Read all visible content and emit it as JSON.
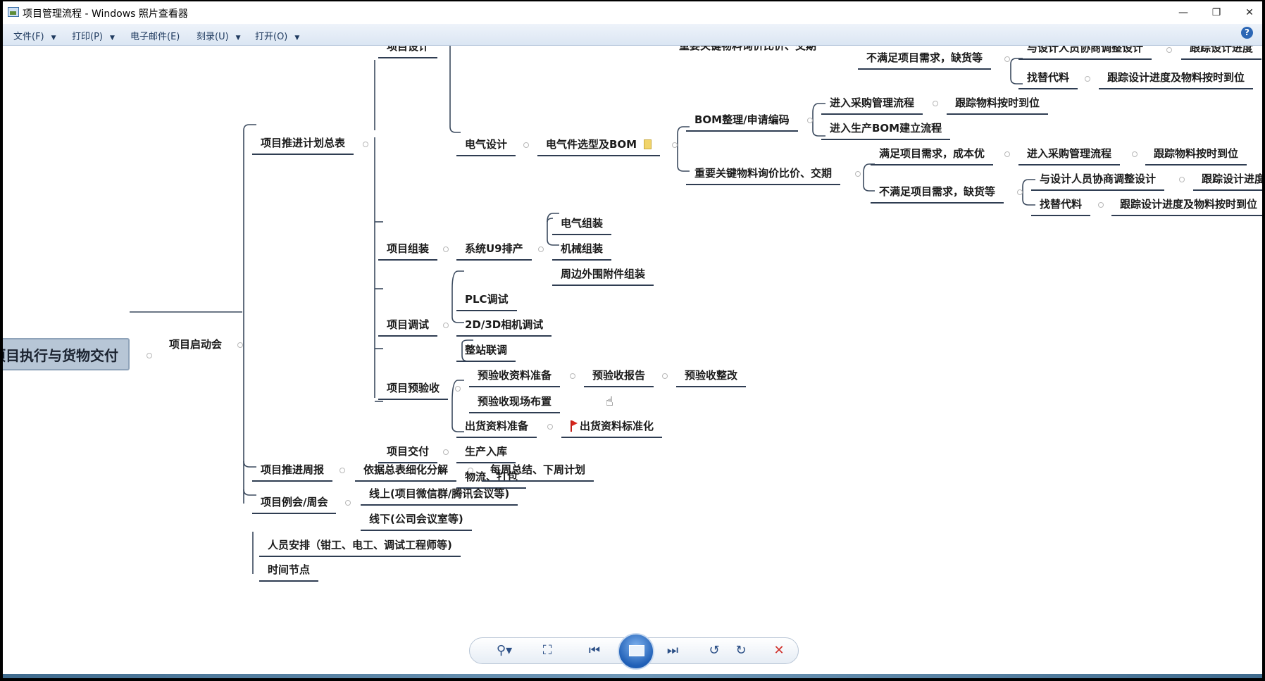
{
  "window": {
    "title": "项目管理流程 - Windows 照片查看器",
    "controls": {
      "minimize": "—",
      "restore": "❐",
      "close": "✕"
    }
  },
  "menu": [
    {
      "label": "文件(F)",
      "arrow": "▼"
    },
    {
      "label": "打印(P)",
      "arrow": "▼"
    },
    {
      "label": "电子邮件(E)",
      "arrow": ""
    },
    {
      "label": "刻录(U)",
      "arrow": "▼"
    },
    {
      "label": "打开(O)",
      "arrow": "▼"
    }
  ],
  "help": "?",
  "mindmap": {
    "root": "项目执行与货物交付",
    "l1": "项目启动会",
    "l2": [
      "项目推进计划总表",
      "项目推进周报",
      "项目例会/周会",
      "人员安排（钳工、电工、调试工程师等)",
      "时间节点"
    ],
    "l3": [
      "项目设计",
      "项目组装",
      "项目调试",
      "项目预验收",
      "项目交付"
    ],
    "design": {
      "top_partial": "重要关键物料询价比价、交期",
      "electric": "电气设计",
      "electric_bom": "电气件选型及BOM",
      "bom_code": "BOM整理/申请编码",
      "purchase_flow": "进入采购管理流程",
      "track_material": "跟踪物料按时到位",
      "prod_bom": "进入生产BOM建立流程",
      "key_material": "重要关键物料询价比价、交期",
      "meet_need": "满足项目需求，成本优",
      "not_meet": "不满足项目需求，缺货等",
      "negotiate": "与设计人员协商调整设计",
      "track_design": "跟踪设计进度",
      "substitute": "找替代料",
      "track_design_material": "跟踪设计进度及物料按时到位"
    },
    "assembly": {
      "u9": "系统U9排产",
      "items": [
        "电气组装",
        "机械组装",
        "周边外围附件组装"
      ]
    },
    "debug": [
      "PLC调试",
      "2D/3D相机调试",
      "整站联调"
    ],
    "preaccept": {
      "data": "预验收资料准备",
      "report": "预验收报告",
      "rectify": "预验收整改",
      "site": "预验收现场布置"
    },
    "delivery": {
      "ship_data": "出货资料准备",
      "standard": "出货资料标准化",
      "warehouse": "生产入库",
      "logistics": "物流、打包"
    },
    "weekly": {
      "detail": "依据总表细化分解",
      "summary": "每周总结、下周计划"
    },
    "meeting": [
      "线上(项目微信群/腾讯会议等)",
      "线下(公司会议室等)"
    ]
  },
  "toolbar": {
    "zoom": "⚲▾",
    "actual_size": "⛶",
    "prev": "⏮",
    "next": "⏭",
    "rotate_ccw": "↺",
    "rotate_cw": "↻",
    "delete": "✕"
  },
  "colors": {
    "menubar": "#dbe6f3",
    "root_fill": "#b7c6d6",
    "line": "#2f3d52",
    "delete_red": "#d0302a"
  }
}
